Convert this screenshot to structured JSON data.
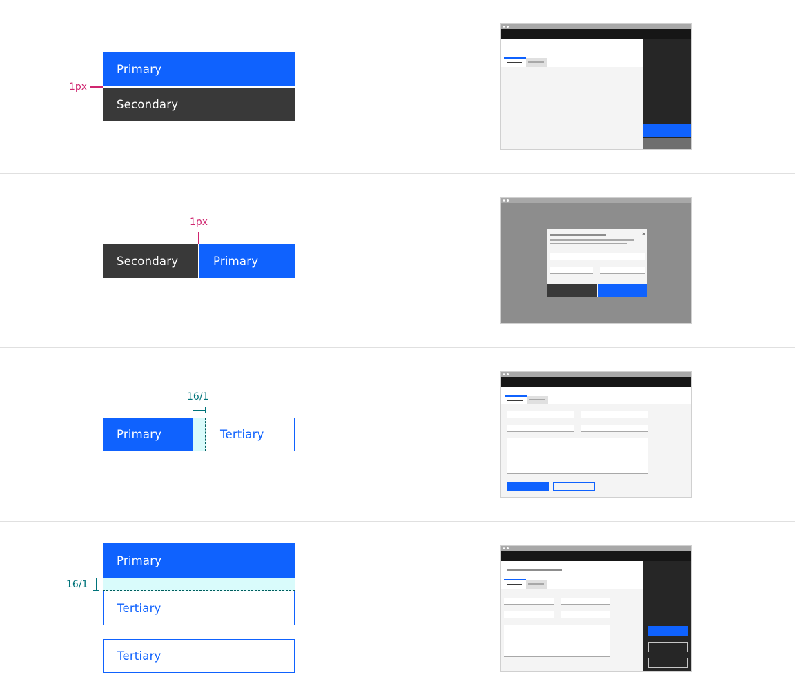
{
  "colors": {
    "primary": "#0f62fe",
    "secondary": "#393939",
    "tertiary_text": "#0f62fe",
    "annotation_pink": "#d02670",
    "annotation_teal": "#00737a",
    "spacer_fill": "#d9fbfb",
    "divider": "#e0e0e0"
  },
  "examples": [
    {
      "buttons": [
        {
          "kind": "primary",
          "label": "Primary"
        },
        {
          "kind": "secondary",
          "label": "Secondary"
        }
      ],
      "annotation": "1px",
      "thumbnail": {
        "type": "side-panel",
        "panel_buttons": [
          "primary",
          "secondary"
        ],
        "close_icon": "×"
      }
    },
    {
      "buttons": [
        {
          "kind": "secondary",
          "label": "Secondary"
        },
        {
          "kind": "primary",
          "label": "Primary"
        }
      ],
      "annotation": "1px",
      "thumbnail": {
        "type": "modal",
        "modal_buttons": [
          "secondary",
          "primary"
        ],
        "close_icon": "×"
      }
    },
    {
      "buttons": [
        {
          "kind": "primary",
          "label": "Primary"
        },
        {
          "kind": "tertiary",
          "label": "Tertiary"
        }
      ],
      "annotation": "16/1",
      "thumbnail": {
        "type": "form-page",
        "form_buttons": [
          "primary",
          "tertiary"
        ]
      }
    },
    {
      "buttons": [
        {
          "kind": "primary",
          "label": "Primary"
        },
        {
          "kind": "tertiary",
          "label": "Tertiary"
        },
        {
          "kind": "tertiary",
          "label": "Tertiary"
        }
      ],
      "annotation": "16/1",
      "thumbnail": {
        "type": "side-panel-form",
        "panel_buttons": [
          "primary",
          "tertiary",
          "tertiary"
        ]
      }
    }
  ]
}
